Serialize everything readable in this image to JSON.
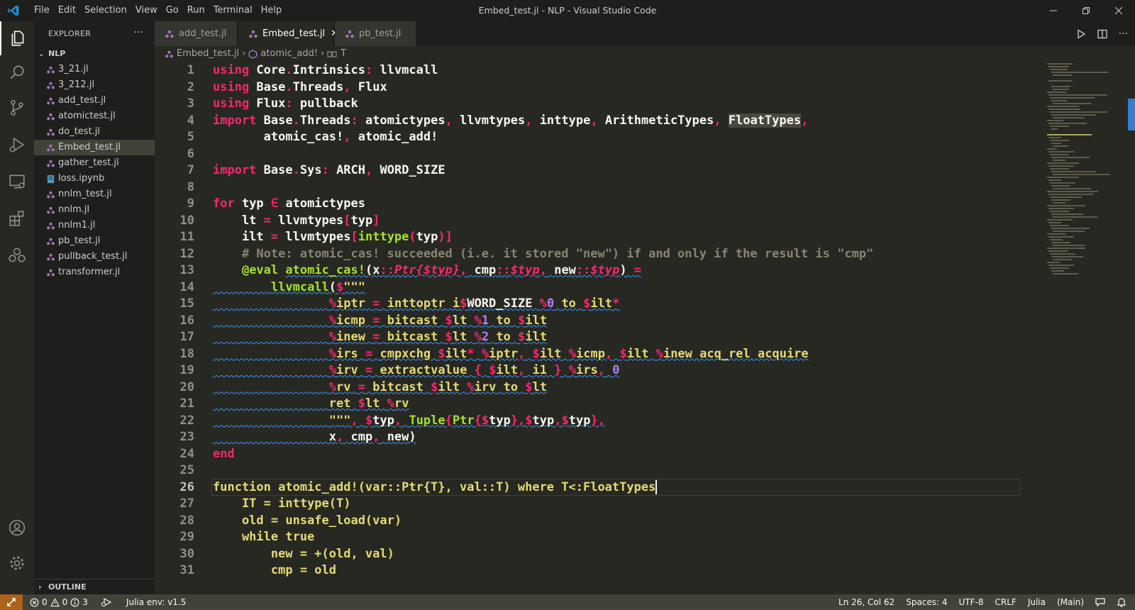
{
  "window": {
    "title": "Embed_test.jl - NLP - Visual Studio Code",
    "menu": [
      "File",
      "Edit",
      "Selection",
      "View",
      "Go",
      "Run",
      "Terminal",
      "Help"
    ]
  },
  "sidebar": {
    "title": "EXPLORER",
    "folder": "NLP",
    "files": [
      "3_21.jl",
      "3_212.jl",
      "add_test.jl",
      "atomictest.jl",
      "do_test.jl",
      "Embed_test.jl",
      "gather_test.jl",
      "loss.ipynb",
      "nnlm_test.jl",
      "nnlm.jl",
      "nnlm1.jl",
      "pb_test.jl",
      "pullback_test.jl",
      "transformer.jl"
    ],
    "selected_file": "Embed_test.jl",
    "outline": "OUTLINE"
  },
  "tabs": [
    {
      "label": "add_test.jl",
      "active": false
    },
    {
      "label": "Embed_test.jl",
      "active": true
    },
    {
      "label": "pb_test.jl",
      "active": false
    }
  ],
  "breadcrumb": {
    "file": "Embed_test.jl",
    "symbol": "atomic_add!",
    "param": "T"
  },
  "editor": {
    "current_line": 26,
    "line_numbers": [
      "1",
      "2",
      "3",
      "4",
      "5",
      "6",
      "7",
      "8",
      "9",
      "10",
      "11",
      "12",
      "13",
      "14",
      "15",
      "16",
      "17",
      "18",
      "19",
      "20",
      "21",
      "22",
      "23",
      "24",
      "25",
      "26",
      "27",
      "28",
      "29",
      "30",
      "31"
    ]
  },
  "statusbar": {
    "errors": "0",
    "warnings": "0",
    "infos": "3",
    "julia_env": "Julia env: v1.5",
    "position": "Ln 26, Col 62",
    "spaces": "Spaces: 4",
    "encoding": "UTF-8",
    "eol": "CRLF",
    "language": "Julia",
    "branch": "(Main)"
  },
  "colors": {
    "accent": "#3794ff",
    "remote": "#ac6218",
    "keyword": "#f92672",
    "function": "#a6e22e",
    "string": "#e6db74"
  }
}
